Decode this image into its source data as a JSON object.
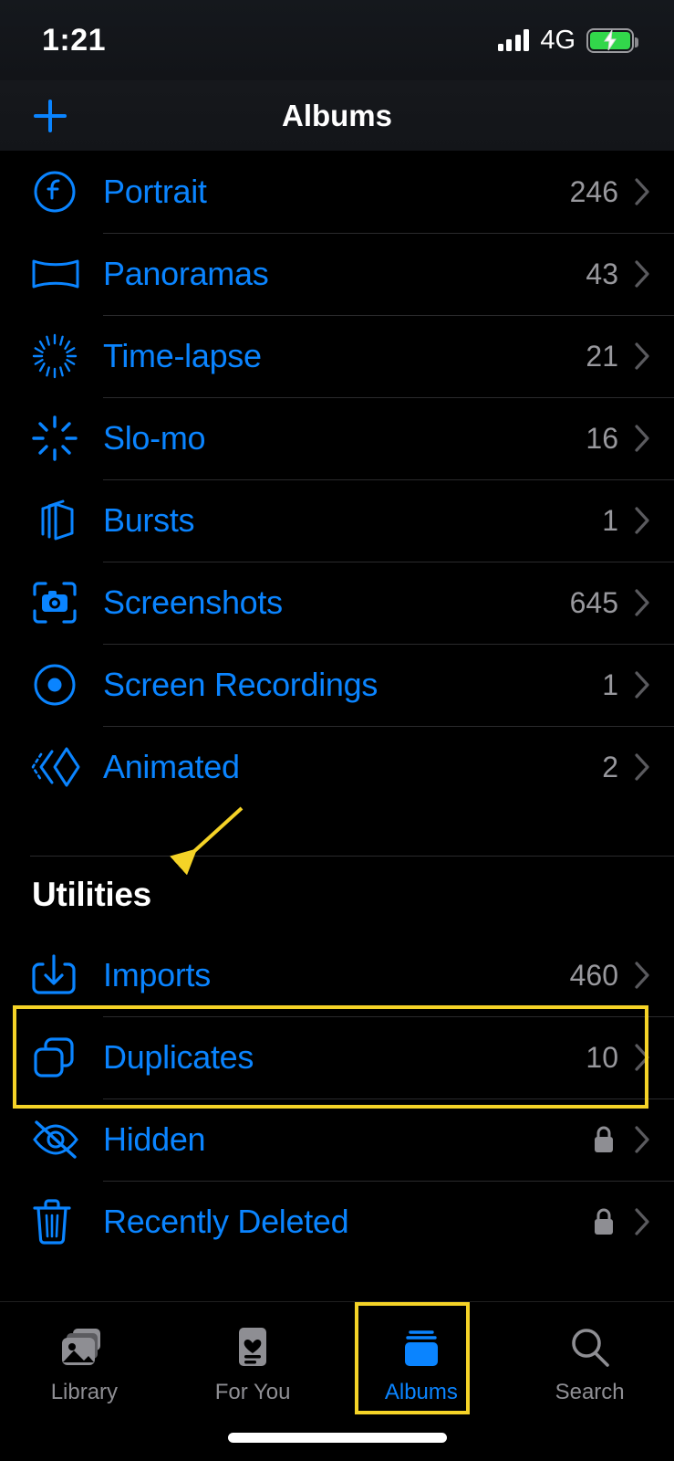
{
  "status_bar": {
    "time": "1:21",
    "network": "4G",
    "signal_icon": "cellular-bars-icon",
    "battery_icon": "battery-charging-icon",
    "battery_color": "#32D74B"
  },
  "nav": {
    "title": "Albums",
    "add_icon": "plus-icon",
    "add_label": "Add Album"
  },
  "theme": {
    "accent": "#0A84FF",
    "highlight": "#F5D327",
    "background": "#000000",
    "count_color": "#98989D"
  },
  "media_types": {
    "rows": [
      {
        "label": "Portrait",
        "count": "246",
        "icon": "portrait-f-stop-icon"
      },
      {
        "label": "Panoramas",
        "count": "43",
        "icon": "panorama-icon"
      },
      {
        "label": "Time-lapse",
        "count": "21",
        "icon": "timelapse-icon"
      },
      {
        "label": "Slo-mo",
        "count": "16",
        "icon": "slomo-icon"
      },
      {
        "label": "Bursts",
        "count": "1",
        "icon": "bursts-stack-icon"
      },
      {
        "label": "Screenshots",
        "count": "645",
        "icon": "screenshot-camera-icon"
      },
      {
        "label": "Screen Recordings",
        "count": "1",
        "icon": "record-circle-icon"
      },
      {
        "label": "Animated",
        "count": "2",
        "icon": "animated-diamond-icon"
      }
    ]
  },
  "utilities": {
    "header": "Utilities",
    "rows": [
      {
        "label": "Imports",
        "count": "460",
        "icon": "import-download-icon",
        "locked": false
      },
      {
        "label": "Duplicates",
        "count": "10",
        "icon": "duplicates-squares-icon",
        "locked": false
      },
      {
        "label": "Hidden",
        "count": "",
        "icon": "eye-slash-icon",
        "locked": true
      },
      {
        "label": "Recently Deleted",
        "count": "",
        "icon": "trash-icon",
        "locked": true
      }
    ]
  },
  "tab_bar": {
    "tabs": [
      {
        "label": "Library",
        "icon": "photo-stack-icon",
        "active": false
      },
      {
        "label": "For You",
        "icon": "for-you-card-icon",
        "active": false
      },
      {
        "label": "Albums",
        "icon": "albums-stack-icon",
        "active": true
      },
      {
        "label": "Search",
        "icon": "magnifier-icon",
        "active": false
      }
    ]
  },
  "annotations": {
    "arrow": {
      "color": "#F5D327",
      "points_to": "Utilities"
    },
    "boxes": [
      {
        "target": "Duplicates",
        "color": "#F5D327"
      },
      {
        "target": "Albums tab",
        "color": "#F5D327"
      }
    ]
  }
}
